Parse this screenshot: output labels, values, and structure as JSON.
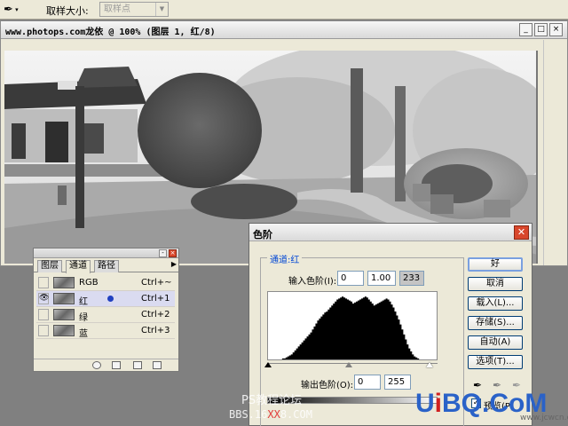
{
  "options_bar": {
    "tool_icon": "eyedropper-icon",
    "sample_size_label": "取样大小:",
    "sample_size_value": "取样点"
  },
  "document": {
    "title": "www.photops.com龙依 @ 100% (图层 1, 红/8)",
    "buttons": {
      "minimize": "_",
      "maximize": "□",
      "close": "×"
    }
  },
  "channels_palette": {
    "tabs": [
      "图层",
      "通道",
      "路径"
    ],
    "active_tab": "通道",
    "rows": [
      {
        "name": "RGB",
        "shortcut": "Ctrl+~",
        "visible": false,
        "selected": false
      },
      {
        "name": "红",
        "shortcut": "Ctrl+1",
        "visible": true,
        "selected": true
      },
      {
        "name": "绿",
        "shortcut": "Ctrl+2",
        "visible": false,
        "selected": false
      },
      {
        "name": "蓝",
        "shortcut": "Ctrl+3",
        "visible": false,
        "selected": false
      }
    ]
  },
  "levels": {
    "title": "色阶",
    "channel_label": "通道:红",
    "input_label": "输入色阶(I):",
    "input_values": [
      "0",
      "1.00",
      "233"
    ],
    "output_label": "输出色阶(O):",
    "output_values": [
      "0",
      "255"
    ],
    "buttons": [
      "好",
      "取消",
      "载入(L)...",
      "存储(S)...",
      "自动(A)",
      "选项(T)..."
    ],
    "preview_label": "预览(P)",
    "preview_checked": true,
    "histogram": [
      0,
      0,
      0,
      0,
      0,
      0,
      0,
      0,
      1,
      1,
      2,
      3,
      4,
      5,
      7,
      9,
      11,
      13,
      15,
      17,
      19,
      21,
      23,
      25,
      27,
      30,
      33,
      36,
      39,
      41,
      43,
      45,
      47,
      48,
      50,
      52,
      54,
      56,
      58,
      60,
      61,
      62,
      63,
      62,
      61,
      60,
      59,
      58,
      56,
      57,
      58,
      59,
      60,
      61,
      62,
      63,
      62,
      60,
      58,
      56,
      54,
      55,
      56,
      57,
      58,
      59,
      60,
      61,
      60,
      58,
      55,
      52,
      48,
      44,
      40,
      35,
      30,
      25,
      20,
      15,
      11,
      8,
      5,
      3,
      2,
      1,
      0,
      0,
      0,
      0,
      0,
      0,
      0,
      0,
      0,
      0
    ]
  },
  "watermarks": {
    "line1": "PS教程论坛",
    "line2_prefix": "BBS.16",
    "line2_red": "XX",
    "line2_suffix": "8.COM",
    "brand_pre": "U",
    "brand_accent": "i",
    "brand_post": "BQ.CoM",
    "small": "www.jcwcn.com"
  }
}
